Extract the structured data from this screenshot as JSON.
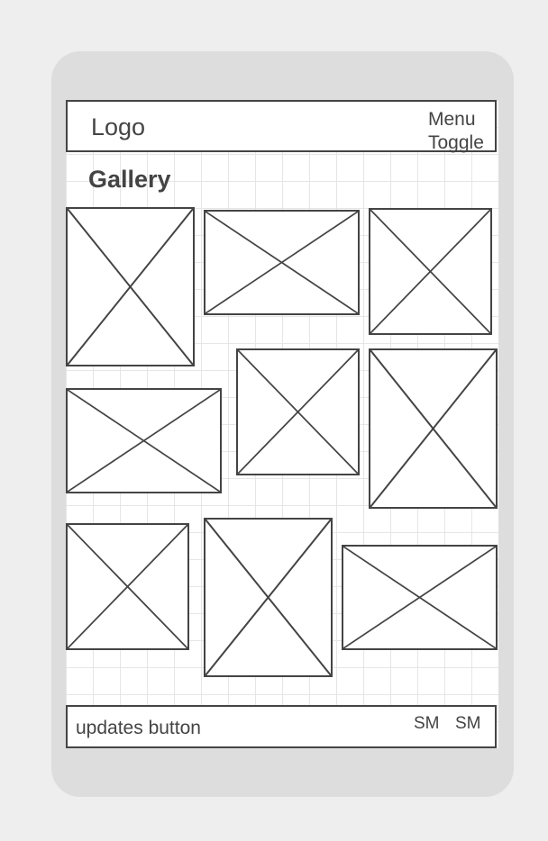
{
  "header": {
    "logo": "Logo",
    "menu_toggle": "Menu Toggle"
  },
  "main": {
    "title": "Gallery",
    "image_placeholder_count": 9
  },
  "footer": {
    "updates_button": "updates button",
    "social_links": [
      "SM",
      "SM"
    ]
  }
}
